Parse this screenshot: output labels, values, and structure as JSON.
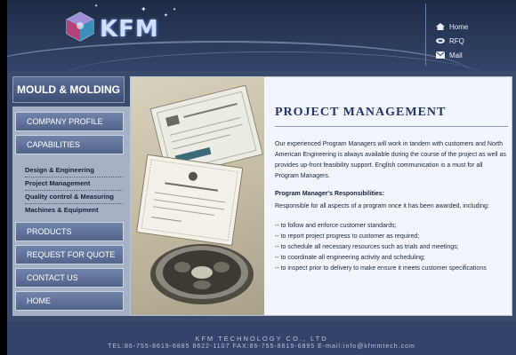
{
  "brand": {
    "name": "KFM"
  },
  "topnav": [
    {
      "label": "Home",
      "icon": "home-icon"
    },
    {
      "label": "RFQ",
      "icon": "rfq-icon"
    },
    {
      "label": "Mail",
      "icon": "mail-icon"
    }
  ],
  "sidebar": {
    "title": "MOULD & MOLDING",
    "company_profile": "COMPANY PROFILE",
    "capabilities": "CAPABILITIES",
    "sub_items": [
      "Design & Engineering",
      "Project Management",
      "Quality control & Measuring",
      "Machines & Equipment"
    ],
    "products": "PRODUCTS",
    "rfq": "REQUEST FOR QUOTE",
    "contact": "CONTACT US",
    "home": "HOME"
  },
  "main": {
    "title": "PROJECT MANAGEMENT",
    "intro": "Our experienced Program Managers will work in tandem with customers and North American Engineering is always available during the course of the project as well as provides up-front feasibility support. English communication is a must for all Program Managers.",
    "resp_heading": "Program Manager's Responsibilities:",
    "resp_lead": "Responsible for all aspects of a program once it has been awarded, including:",
    "resp_items": [
      "--  to follow and enforce customer standards;",
      "--  to report project progress to customer as required;",
      "--  to schedule all necessary resources such as trials and meetings;",
      "--  to coordinate all engineering activity and scheduling;",
      "--  to inspect prior to delivery to make ensure it meets customer specifications"
    ]
  },
  "footer": {
    "company": "KFM TECHNOLOGY CO., LTD",
    "contact": "TEL:86-755-8619-6885  8622-1107      FAX:86-755-8619-6895      E-mail:info@kfmmtech.com"
  },
  "colors": {
    "header_bg": "#1c2a44",
    "frame_bg": "#3a4a6a",
    "title_blue": "#23356b",
    "sidebar_button": "#5e7098"
  }
}
